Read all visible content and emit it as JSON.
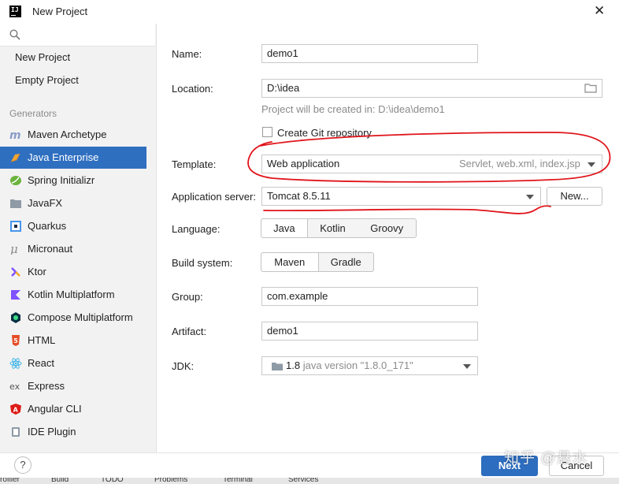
{
  "window": {
    "title": "New Project",
    "close_glyph": "✕"
  },
  "sidebar": {
    "search_placeholder": "",
    "top_items": [
      {
        "label": "New Project"
      },
      {
        "label": "Empty Project"
      }
    ],
    "generators_header": "Generators",
    "generators": [
      {
        "label": "Maven Archetype",
        "icon": "maven-icon",
        "color": "#8a9cc9"
      },
      {
        "label": "Java Enterprise",
        "icon": "java-enterprise-icon",
        "color": "#f0a732",
        "selected": true
      },
      {
        "label": "Spring Initializr",
        "icon": "spring-icon",
        "color": "#6cb33e"
      },
      {
        "label": "JavaFX",
        "icon": "javafx-icon",
        "color": "#8e9aa6"
      },
      {
        "label": "Quarkus",
        "icon": "quarkus-icon",
        "color": "#4695eb"
      },
      {
        "label": "Micronaut",
        "icon": "micronaut-icon",
        "color": "#8a8a8a"
      },
      {
        "label": "Ktor",
        "icon": "ktor-icon",
        "color": "#7f52ff"
      },
      {
        "label": "Kotlin Multiplatform",
        "icon": "kotlin-icon",
        "color": "#7f52ff"
      },
      {
        "label": "Compose Multiplatform",
        "icon": "compose-icon",
        "color": "#3ddc84"
      },
      {
        "label": "HTML",
        "icon": "html5-icon",
        "color": "#e44d26"
      },
      {
        "label": "React",
        "icon": "react-icon",
        "color": "#3fb5e8"
      },
      {
        "label": "Express",
        "icon": "express-icon",
        "color": "#555555"
      },
      {
        "label": "Angular CLI",
        "icon": "angular-icon",
        "color": "#dd1b16"
      },
      {
        "label": "IDE Plugin",
        "icon": "plugin-icon",
        "color": "#8e9aa6"
      }
    ]
  },
  "form": {
    "name": {
      "label": "Name:",
      "value": "demo1"
    },
    "location": {
      "label": "Location:",
      "value": "D:\\idea",
      "hint": "Project will be created in: D:\\idea\\demo1"
    },
    "git": {
      "label": "Create Git repository",
      "checked": false
    },
    "template": {
      "label": "Template:",
      "value": "Web application",
      "detail": "Servlet, web.xml, index.jsp"
    },
    "app_server": {
      "label": "Application server:",
      "value": "Tomcat 8.5.11",
      "new_button": "New..."
    },
    "language": {
      "label": "Language:",
      "options": [
        "Java",
        "Kotlin",
        "Groovy"
      ],
      "selected": "Java"
    },
    "build_system": {
      "label": "Build system:",
      "options": [
        "Maven",
        "Gradle"
      ],
      "selected": "Maven"
    },
    "group": {
      "label": "Group:",
      "value": "com.example"
    },
    "artifact": {
      "label": "Artifact:",
      "value": "demo1"
    },
    "jdk": {
      "label": "JDK:",
      "version": "1.8",
      "detail": "java version \"1.8.0_171\""
    }
  },
  "footer": {
    "help": "?",
    "next": "Next",
    "cancel": "Cancel"
  },
  "watermark": "知乎 @悬水",
  "statusbar": [
    "rofiler",
    "Build",
    "TODO",
    "Problems",
    "Terminal",
    "Services"
  ],
  "colors": {
    "accent": "#2f6fc0",
    "annotation": "#e0141a"
  }
}
